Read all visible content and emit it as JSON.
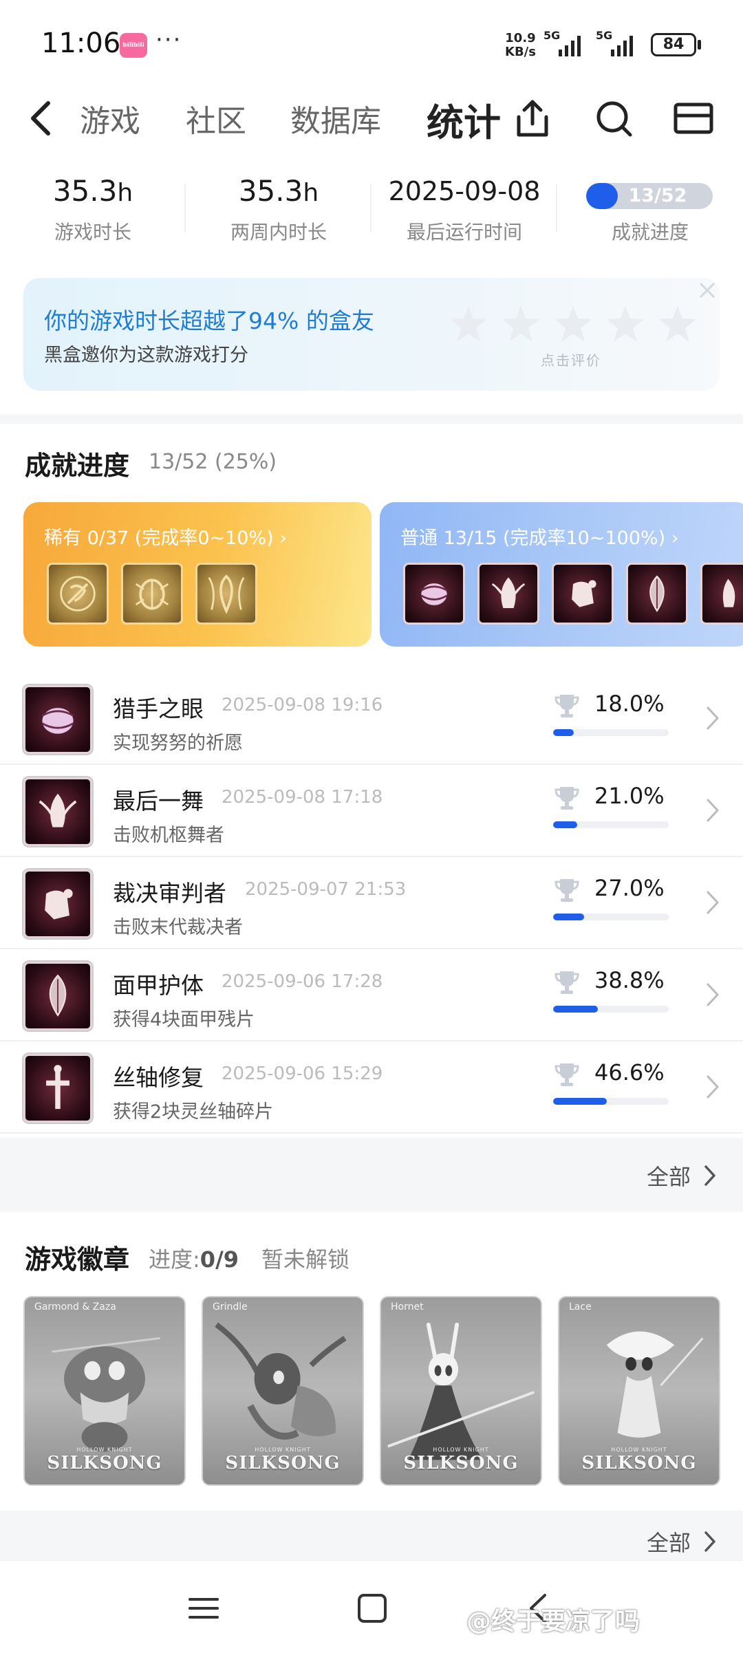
{
  "status_bar": {
    "time": "11:06",
    "app_badge": "bilibili",
    "dots": "···",
    "net_speed_value": "10.9",
    "net_speed_unit": "KB/s",
    "signal_1": "5G",
    "signal_2": "5G",
    "battery": "84"
  },
  "nav": {
    "tabs": [
      {
        "label": "游戏"
      },
      {
        "label": "社区"
      },
      {
        "label": "数据库"
      },
      {
        "label": "统计"
      }
    ],
    "active_tab": "统计"
  },
  "stats": {
    "play_time_value": "35.3",
    "play_time_unit": "h",
    "play_time_label": "游戏时长",
    "two_week_value": "35.3",
    "two_week_unit": "h",
    "two_week_label": "两周内时长",
    "last_run_value": "2025-09-08",
    "last_run_label": "最后运行时间",
    "achievement_progress_text": "13/52",
    "achievement_progress_fraction": 0.25,
    "achievement_progress_label": "成就进度"
  },
  "rating_card": {
    "title": "你的游戏时长超越了94% 的盒友",
    "subtitle": "黑盒邀你为这款游戏打分",
    "hint": "点击评价",
    "stars": 5
  },
  "achievements": {
    "heading": "成就进度",
    "summary": "13/52 (25%)",
    "rare_label": "稀有 0/37 (完成率0~10%) ›",
    "common_label": "普通 13/15 (完成率10~100%) ›",
    "items": [
      {
        "name": "猎手之眼",
        "date": "2025-09-08 19:16",
        "desc": "实现努努的祈愿",
        "percent": "18.0%",
        "percent_value": 18.0
      },
      {
        "name": "最后一舞",
        "date": "2025-09-08 17:18",
        "desc": "击败机枢舞者",
        "percent": "21.0%",
        "percent_value": 21.0
      },
      {
        "name": "裁决审判者",
        "date": "2025-09-07 21:53",
        "desc": "击败末代裁决者",
        "percent": "27.0%",
        "percent_value": 27.0
      },
      {
        "name": "面甲护体",
        "date": "2025-09-06 17:28",
        "desc": "获得4块面甲残片",
        "percent": "38.8%",
        "percent_value": 38.8
      },
      {
        "name": "丝轴修复",
        "date": "2025-09-06 15:29",
        "desc": "获得2块灵丝轴碎片",
        "percent": "46.6%",
        "percent_value": 46.6
      }
    ],
    "more": "全部"
  },
  "game_badges": {
    "heading": "游戏徽章",
    "progress_label": "进度:",
    "progress_value": "0/9",
    "locked": "暂未解锁",
    "cards": [
      {
        "name": "Garmond & Zaza",
        "logo": "SILKSONG",
        "logo_small": "HOLLOW KNIGHT"
      },
      {
        "name": "Grindle",
        "logo": "SILKSONG",
        "logo_small": "HOLLOW KNIGHT"
      },
      {
        "name": "Hornet",
        "logo": "SILKSONG",
        "logo_small": "HOLLOW KNIGHT"
      },
      {
        "name": "Lace",
        "logo": "SILKSONG",
        "logo_small": "HOLLOW KNIGHT"
      }
    ],
    "more": "全部"
  },
  "watermark": "@终于要凉了吗",
  "colors": {
    "accent": "#1e5ee9",
    "rating_title": "#1f7dd6",
    "rare_card": "#f7a83a",
    "common_card": "#90b6f5"
  }
}
